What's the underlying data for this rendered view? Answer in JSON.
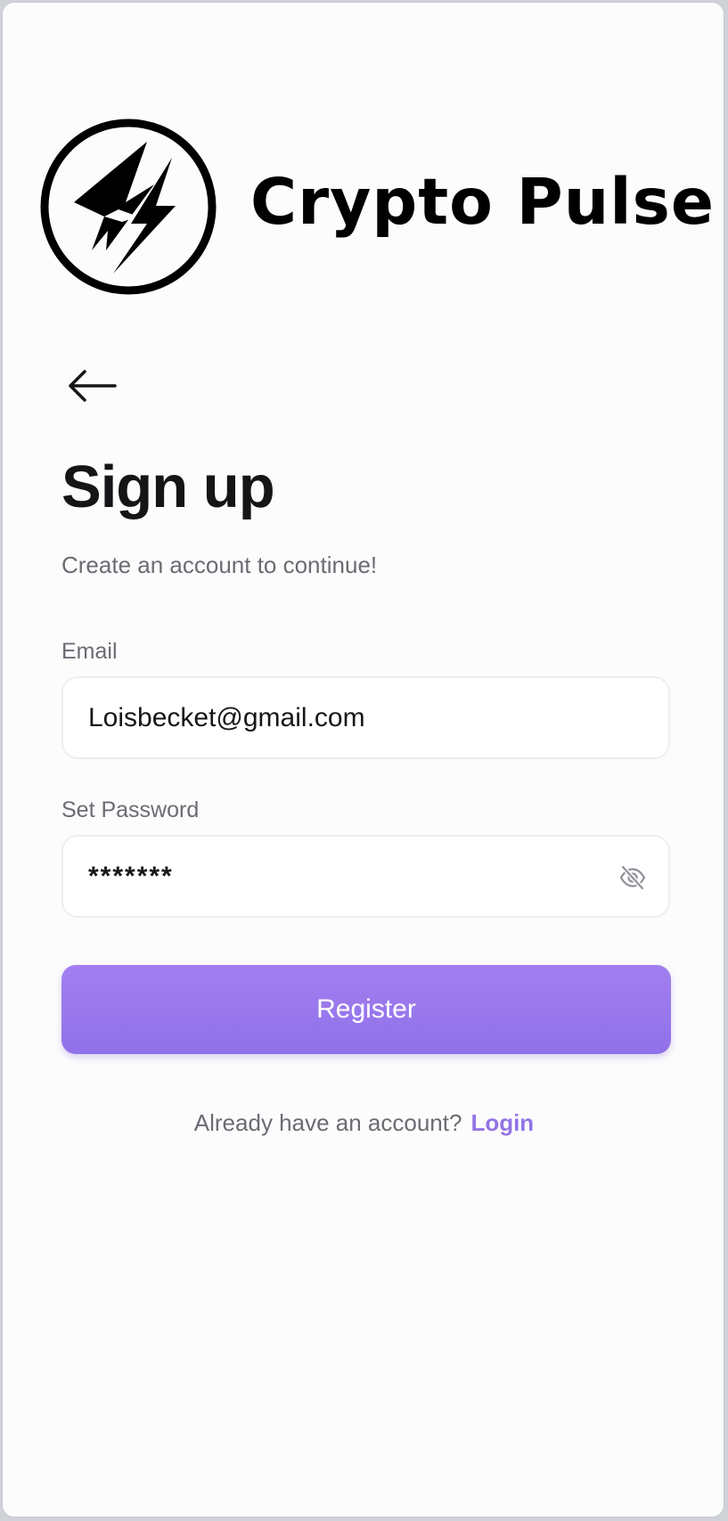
{
  "brand": {
    "name": "Crypto Pulse"
  },
  "page": {
    "title": "Sign up",
    "subtitle": "Create an account to continue!"
  },
  "email": {
    "label": "Email",
    "value": "Loisbecket@gmail.com"
  },
  "password": {
    "label": "Set Password",
    "value": "*******"
  },
  "register": {
    "label": "Register"
  },
  "footer": {
    "prompt": "Already have an account?",
    "login_label": "Login"
  },
  "icons": {
    "back": "arrow-left-icon",
    "visibility": "eye-off-icon",
    "logo": "lightning-logo-icon"
  },
  "colors": {
    "accent": "#9274e6",
    "button_gradient_top": "#a27ff0",
    "button_gradient_bottom": "#9171e9",
    "heading": "#151517",
    "muted_text": "#6a6c73"
  }
}
